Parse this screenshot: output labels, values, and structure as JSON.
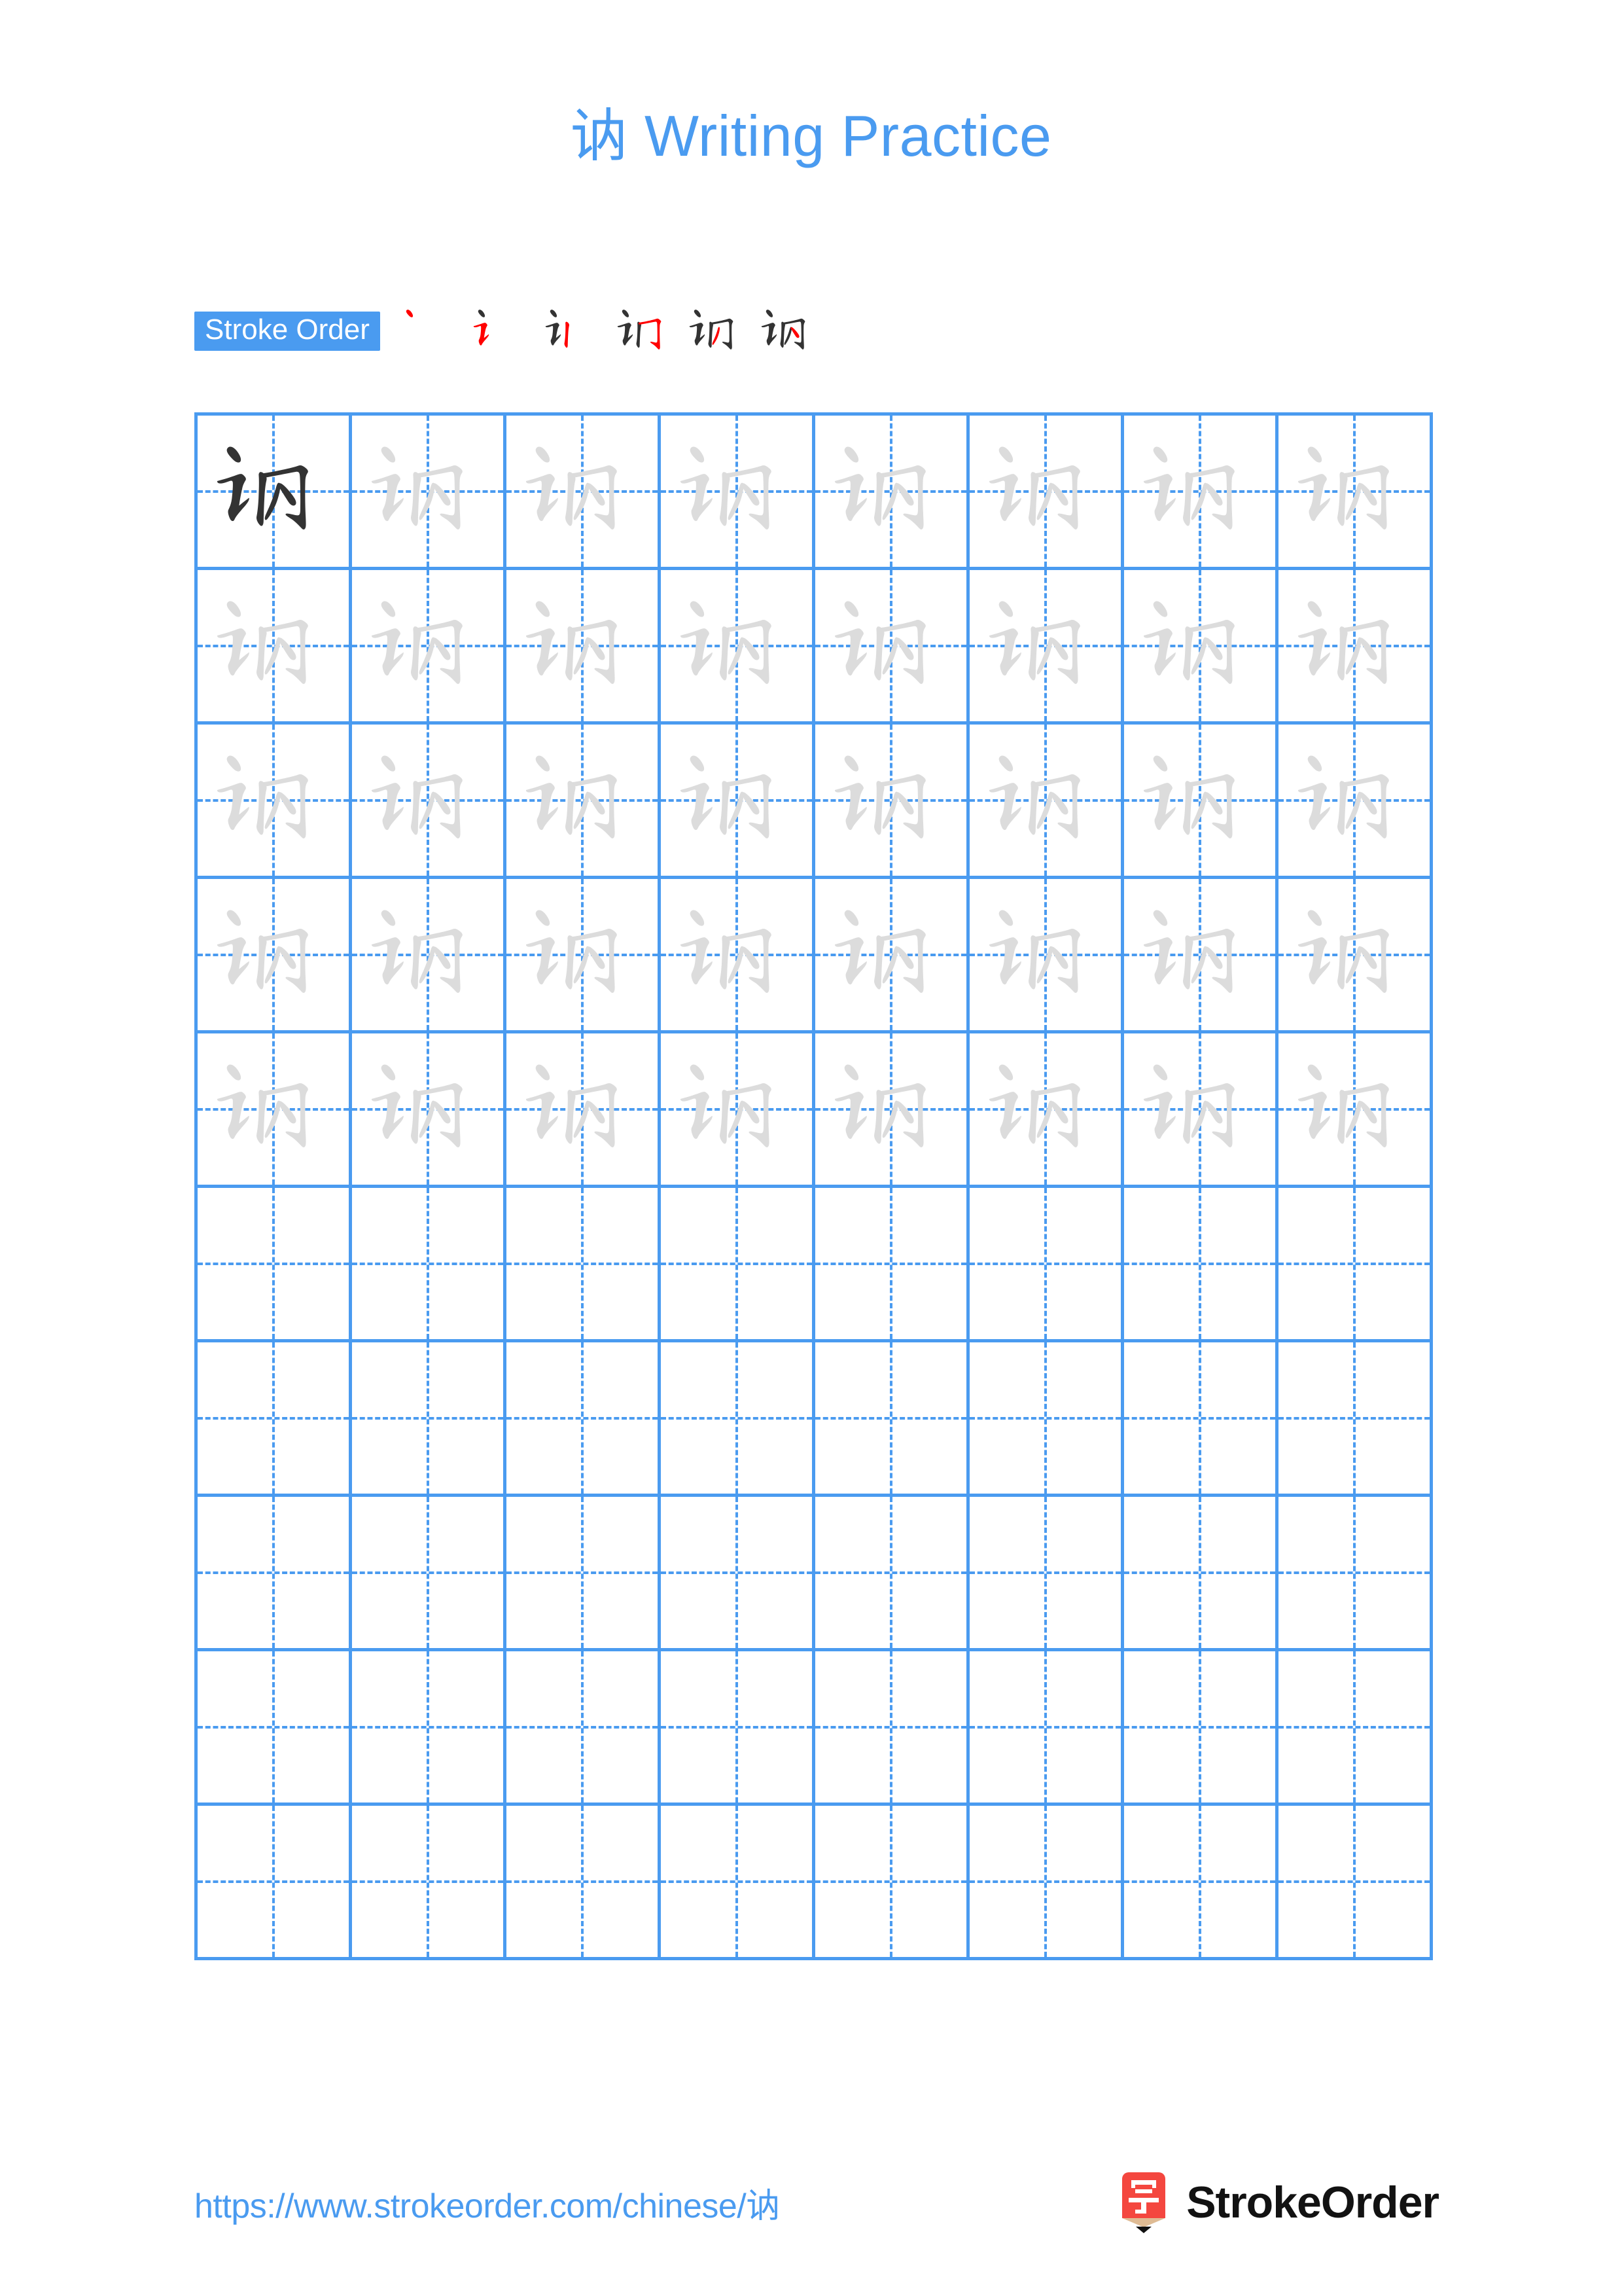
{
  "page": {
    "character": "讷",
    "title_suffix": " Writing Practice",
    "title_full": "讷 Writing Practice",
    "accent_color": "#4a9bf0",
    "trace_color": "#dcdcdc",
    "ink_color": "#333333",
    "highlight_stroke_color": "#ff0000"
  },
  "stroke_order": {
    "badge_label": "Stroke Order",
    "stroke_count": 6,
    "steps": [
      {
        "index": 1,
        "strokes_shown": 1,
        "new_stroke": 1,
        "label": "丶"
      },
      {
        "index": 2,
        "strokes_shown": 2,
        "new_stroke": 2,
        "label": "讠"
      },
      {
        "index": 3,
        "strokes_shown": 3,
        "new_stroke": 3,
        "label": "讠丨"
      },
      {
        "index": 4,
        "strokes_shown": 4,
        "new_stroke": 4,
        "label": "订"
      },
      {
        "index": 5,
        "strokes_shown": 5,
        "new_stroke": 5,
        "label": "讷"
      },
      {
        "index": 6,
        "strokes_shown": 6,
        "new_stroke": 6,
        "label": "讷"
      }
    ]
  },
  "grid": {
    "columns": 8,
    "rows": 10,
    "cell_size_px": 236,
    "filled_rows": 5,
    "rows_data": [
      [
        "ink",
        "trace",
        "trace",
        "trace",
        "trace",
        "trace",
        "trace",
        "trace"
      ],
      [
        "trace",
        "trace",
        "trace",
        "trace",
        "trace",
        "trace",
        "trace",
        "trace"
      ],
      [
        "trace",
        "trace",
        "trace",
        "trace",
        "trace",
        "trace",
        "trace",
        "trace"
      ],
      [
        "trace",
        "trace",
        "trace",
        "trace",
        "trace",
        "trace",
        "trace",
        "trace"
      ],
      [
        "trace",
        "trace",
        "trace",
        "trace",
        "trace",
        "trace",
        "trace",
        "trace"
      ],
      [
        "empty",
        "empty",
        "empty",
        "empty",
        "empty",
        "empty",
        "empty",
        "empty"
      ],
      [
        "empty",
        "empty",
        "empty",
        "empty",
        "empty",
        "empty",
        "empty",
        "empty"
      ],
      [
        "empty",
        "empty",
        "empty",
        "empty",
        "empty",
        "empty",
        "empty",
        "empty"
      ],
      [
        "empty",
        "empty",
        "empty",
        "empty",
        "empty",
        "empty",
        "empty",
        "empty"
      ],
      [
        "empty",
        "empty",
        "empty",
        "empty",
        "empty",
        "empty",
        "empty",
        "empty"
      ]
    ]
  },
  "footer": {
    "url": "https://www.strokeorder.com/chinese/讷",
    "brand_name": "StrokeOrder",
    "logo_character": "字",
    "logo_body_color": "#f4473f",
    "logo_tip_color": "#dfbb94",
    "logo_point_color": "#111111"
  }
}
